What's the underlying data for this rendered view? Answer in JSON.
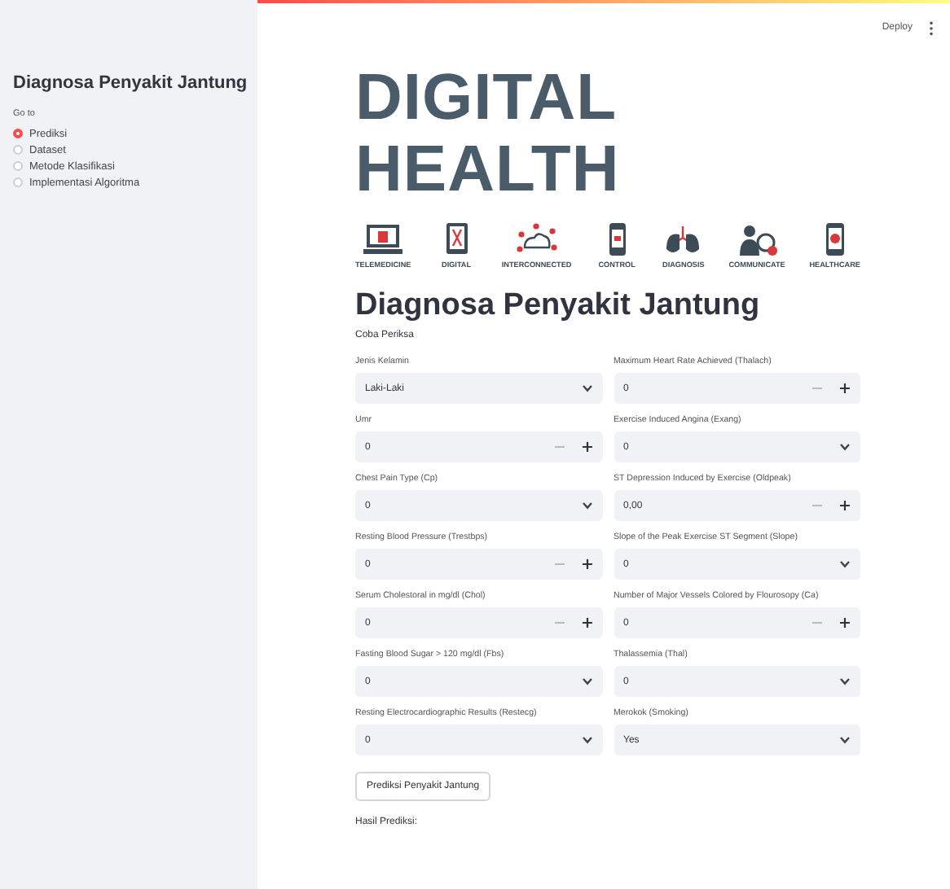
{
  "header": {
    "deploy": "Deploy"
  },
  "sidebar": {
    "title": "Diagnosa Penyakit Jantung",
    "radio_label": "Go to",
    "items": [
      {
        "label": "Prediksi",
        "selected": true
      },
      {
        "label": "Dataset",
        "selected": false
      },
      {
        "label": "Metode Klasifikasi",
        "selected": false
      },
      {
        "label": "Implementasi Algoritma",
        "selected": false
      }
    ]
  },
  "banner": {
    "title": "DIGITAL HEALTH",
    "captions": [
      "TELEMEDICINE",
      "DIGITAL",
      "INTERCONNECTED",
      "CONTROL",
      "DIAGNOSIS",
      "COMMUNICATE",
      "HEALTHCARE"
    ]
  },
  "heading": "Diagnosa Penyakit Jantung",
  "subheading": "Coba Periksa",
  "form_rows": [
    [
      {
        "label": "Jenis Kelamin",
        "kind": "select",
        "value": "Laki-Laki"
      },
      {
        "label": "Maximum Heart Rate Achieved (Thalach)",
        "kind": "number",
        "value": "0"
      }
    ],
    [
      {
        "label": "Umr",
        "kind": "number",
        "value": "0"
      },
      {
        "label": "Exercise Induced Angina (Exang)",
        "kind": "select",
        "value": "0"
      }
    ],
    [
      {
        "label": "Chest Pain Type (Cp)",
        "kind": "select",
        "value": "0"
      },
      {
        "label": "ST Depression Induced by Exercise (Oldpeak)",
        "kind": "number",
        "value": "0,00"
      }
    ],
    [
      {
        "label": "Resting Blood Pressure (Trestbps)",
        "kind": "number",
        "value": "0"
      },
      {
        "label": "Slope of the Peak Exercise ST Segment (Slope)",
        "kind": "select",
        "value": "0"
      }
    ],
    [
      {
        "label": "Serum Cholestoral in mg/dl (Chol)",
        "kind": "number",
        "value": "0"
      },
      {
        "label": "Number of Major Vessels Colored by Flourosopy (Ca)",
        "kind": "number",
        "value": "0"
      }
    ],
    [
      {
        "label": "Fasting Blood Sugar > 120 mg/dl (Fbs)",
        "kind": "select",
        "value": "0"
      },
      {
        "label": "Thalassemia (Thal)",
        "kind": "select",
        "value": "0"
      }
    ],
    [
      {
        "label": "Resting Electrocardiographic Results (Restecg)",
        "kind": "select",
        "value": "0"
      },
      {
        "label": "Merokok (Smoking)",
        "kind": "select",
        "value": "Yes"
      }
    ]
  ],
  "button": "Prediksi Penyakit Jantung",
  "result_label": "Hasil Prediksi:"
}
